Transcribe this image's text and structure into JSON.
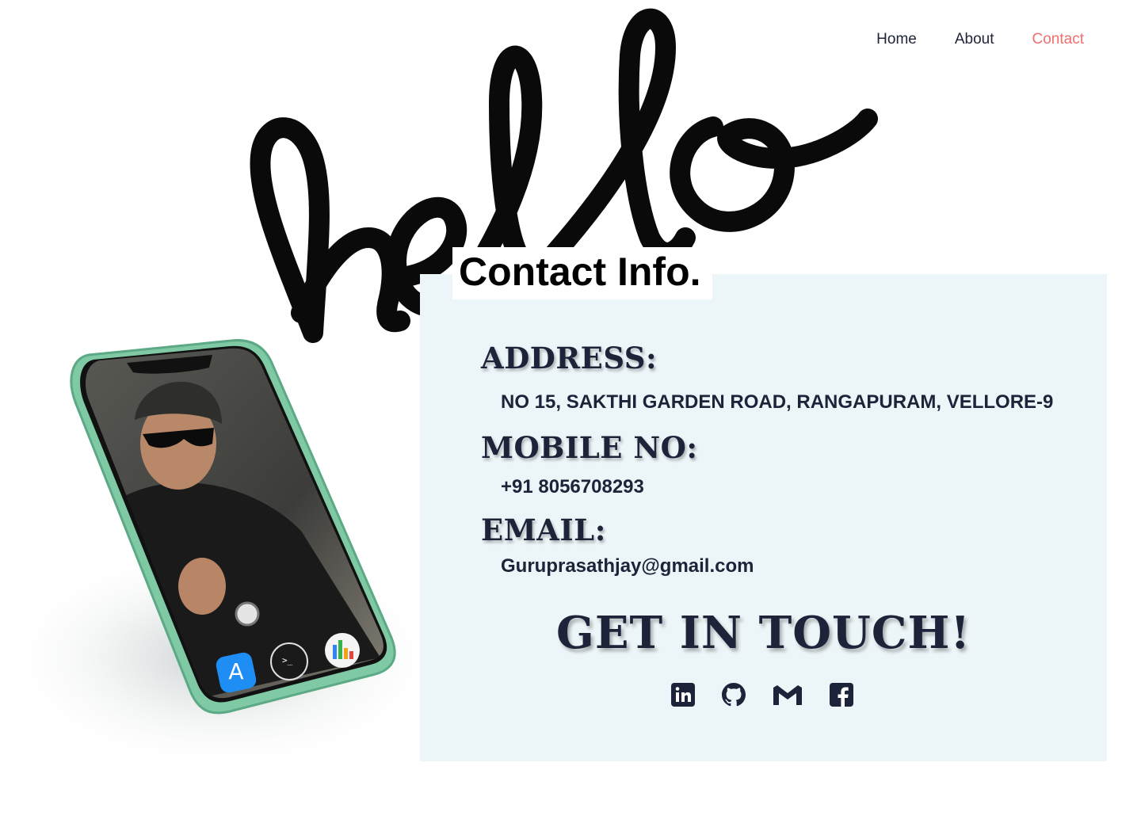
{
  "nav": {
    "items": [
      {
        "label": "Home"
      },
      {
        "label": "About"
      },
      {
        "label": "Contact"
      }
    ],
    "active": "Contact",
    "active_color": "#f16e6e",
    "text_color": "#1d2339"
  },
  "hero": {
    "script_text": "hello"
  },
  "contact": {
    "title": "Contact Info.",
    "address_label": "ADDRESS:",
    "address_value": "NO 15, SAKTHI GARDEN ROAD, RANGAPURAM, VELLORE-9",
    "mobile_label": "MOBILE NO:",
    "mobile_value": "+91 8056708293",
    "email_label": "EMAIL:",
    "email_value": "Guruprasathjay@gmail.com",
    "cta": "GET IN TOUCH!",
    "panel_color": "#ecf5f8"
  },
  "socials": [
    {
      "icon": "linkedin-icon"
    },
    {
      "icon": "github-icon"
    },
    {
      "icon": "gmail-icon"
    },
    {
      "icon": "facebook-icon"
    }
  ],
  "phone": {
    "dock_icons": [
      "app-store-icon",
      "terminal-icon",
      "numbers-icon"
    ]
  }
}
